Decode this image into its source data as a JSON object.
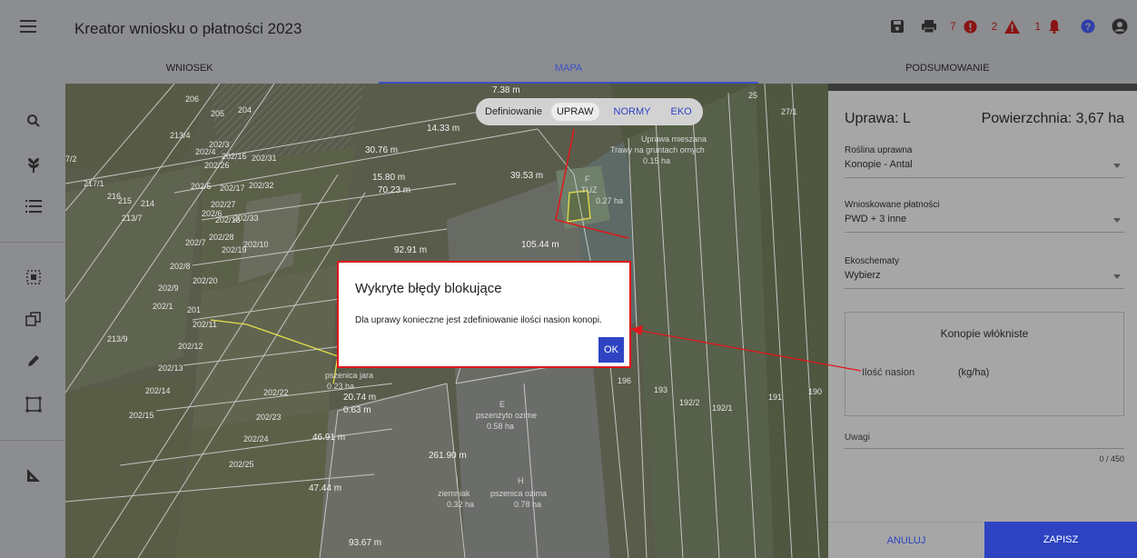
{
  "app": {
    "title": "Kreator wniosku o płatności 2023"
  },
  "status": {
    "errors": "7",
    "warnings": "2",
    "notifications": "1"
  },
  "tabs": [
    {
      "label": "WNIOSEK"
    },
    {
      "label": "MAPA"
    },
    {
      "label": "PODSUMOWANIE"
    }
  ],
  "active_tab": 1,
  "mode_toggle": {
    "label": "Definiowanie",
    "options": [
      "UPRAW",
      "NORMY",
      "EKO"
    ],
    "selected": "UPRAW"
  },
  "map": {
    "parcel_labels": [
      "206",
      "205",
      "204",
      "213/4",
      "202/3",
      "202/4",
      "202/16",
      "202/26",
      "202/31",
      "202/32",
      "202/5",
      "202/17",
      "202/27",
      "202/33",
      "217/1",
      "216",
      "215",
      "214",
      "213/7",
      "202/6",
      "202/18",
      "202/7",
      "202/19",
      "202/10",
      "202/28",
      "202/8",
      "202/9",
      "202/20",
      "202/1",
      "201",
      "202/11",
      "213/9",
      "202/12",
      "202/13",
      "202/14",
      "202/22",
      "202/15",
      "202/23",
      "202/24",
      "202/25",
      "196",
      "193",
      "192/2",
      "192/1",
      "191",
      "190",
      "27/1",
      "25",
      "7/2"
    ],
    "measurements": [
      "14.33 m",
      "30.76 m",
      "15.80 m",
      "70.23 m",
      "39.53 m",
      "105.44 m",
      "92.91 m",
      "20.74 m",
      "0.63 m",
      "46.91 m",
      "261.90 m",
      "47.44 m",
      "93.67 m",
      "7.38 m"
    ],
    "crop_labels": [
      {
        "code": "",
        "name": "Uprawa mieszana",
        "area": ""
      },
      {
        "code": "",
        "name": "Trawy na gruntach ornych",
        "area": "0.15 ha"
      },
      {
        "code": "F",
        "name": "",
        "area": ""
      },
      {
        "code": "TUZ",
        "name": "",
        "area": "0.27 ha"
      },
      {
        "code": "",
        "name": "pszenica jara",
        "area": "0.23 ha"
      },
      {
        "code": "E",
        "name": "pszenżyto ozime",
        "area": "0.58 ha"
      },
      {
        "code": "I",
        "name": "ziemniak",
        "area": "0.32 ha"
      },
      {
        "code": "H",
        "name": "pszenica ozima",
        "area": "0.78 ha"
      }
    ]
  },
  "panel": {
    "title": "Uprawa: L",
    "area": "Powierzchnia: 3,67 ha",
    "fields": [
      {
        "label": "Roślina uprawna",
        "value": "Konopie - Antal"
      },
      {
        "label": "Wnioskowane płatności",
        "value": "PWD + 3 inne"
      },
      {
        "label": "Ekoschematy",
        "value": "Wybierz"
      }
    ],
    "hemp_box": {
      "title": "Konopie włókniste",
      "seed_label": "Ilość nasion",
      "unit": "(kg/ha)"
    },
    "notes_label": "Uwagi",
    "notes_count": "0 / 450",
    "cancel_label": "ANULUJ",
    "save_label": "ZAPISZ"
  },
  "dialog": {
    "title": "Wykryte błędy blokujące",
    "message": "Dla uprawy konieczne jest zdefiniowanie ilości nasion konopi.",
    "ok_label": "OK"
  },
  "colors": {
    "accent": "#2e43c2",
    "error": "#e0161b",
    "overlay": "#8b8d90"
  }
}
